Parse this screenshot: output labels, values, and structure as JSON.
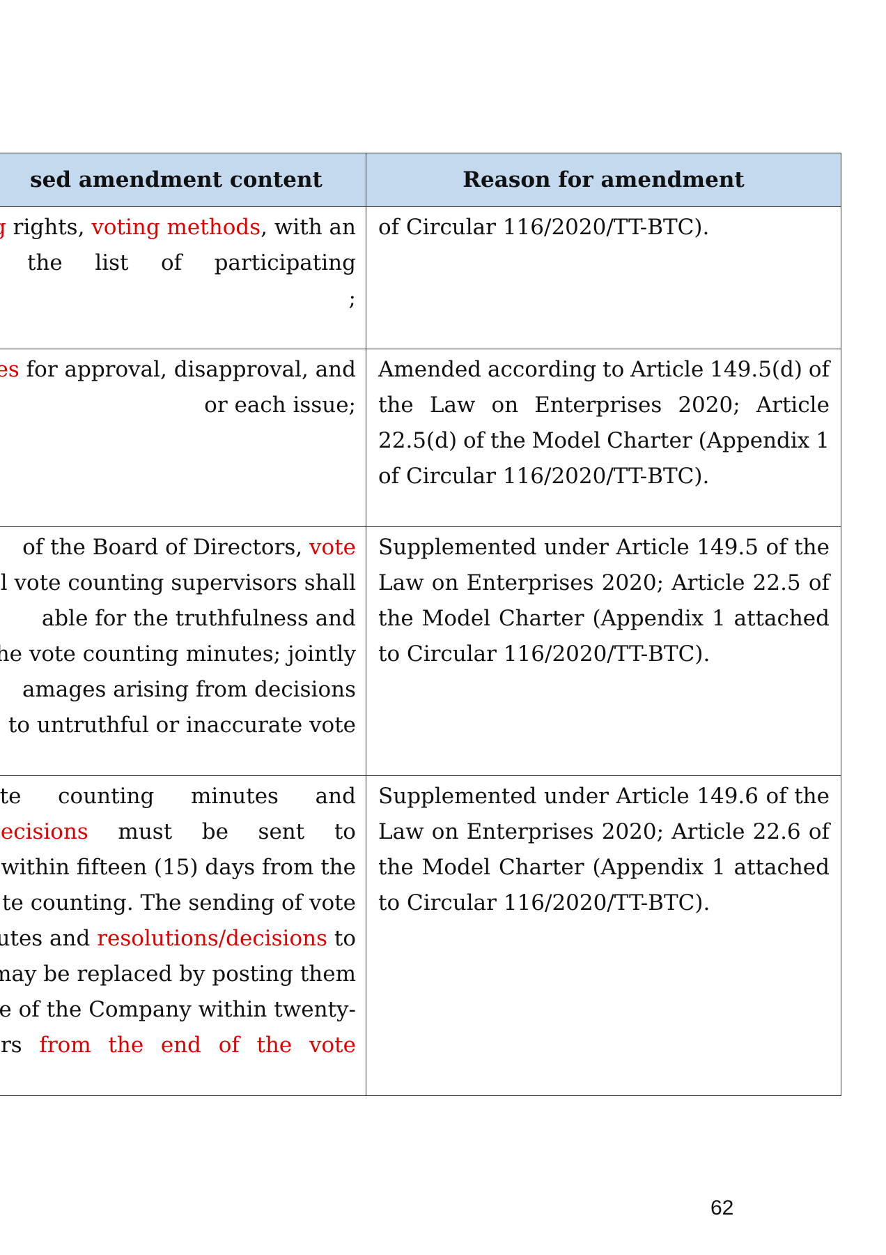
{
  "header": {
    "col1": "sed amendment content",
    "col2": "Reason for amendment"
  },
  "rows": [
    {
      "left": [
        {
          "segments": [
            {
              "t": "g",
              "red": true
            },
            {
              "t": " rights, "
            },
            {
              "t": "voting methods",
              "red": true
            },
            {
              "t": ", with an"
            }
          ]
        },
        {
          "words": [
            "f",
            "the",
            "list",
            "of",
            "participating"
          ]
        },
        {
          "segments": [
            {
              "t": ";"
            }
          ]
        }
      ],
      "right": [
        "of Circular 116/2020/TT-BTC)."
      ]
    },
    {
      "left": [
        {
          "segments": [
            {
              "t": "es",
              "red": true
            },
            {
              "t": " for approval, disapproval, and"
            }
          ]
        },
        {
          "segments": [
            {
              "t": "or each issue;"
            }
          ]
        }
      ],
      "right": [
        "Amended according to Article 149.5(d) of",
        "the Law on Enterprises 2020; Article",
        "22.5(d) of the Model Charter (Appendix 1",
        "of Circular 116/2020/TT-BTC)."
      ]
    },
    {
      "left": [
        {
          "segments": [
            {
              "t": "of the Board of Directors, "
            },
            {
              "t": "vote",
              "red": true
            }
          ]
        },
        {
          "segments": [
            {
              "t": "l vote counting supervisors shall"
            }
          ]
        },
        {
          "segments": [
            {
              "t": "able for the truthfulness and"
            }
          ]
        },
        {
          "segments": [
            {
              "t": "he vote counting minutes; jointly"
            }
          ]
        },
        {
          "segments": [
            {
              "t": "amages arising from decisions"
            }
          ]
        },
        {
          "segments": [
            {
              "t": " to untruthful or inaccurate vote"
            }
          ]
        }
      ],
      "right": [
        "Supplemented under Article 149.5 of the",
        "Law on Enterprises 2020; Article 22.5 of",
        "the Model Charter (Appendix 1 attached",
        "to Circular 116/2020/TT-BTC)."
      ]
    },
    {
      "left": [
        {
          "words": [
            "ote",
            "counting",
            "minutes",
            "and"
          ]
        },
        {
          "wordsRed": [
            [
              "decisions",
              true
            ],
            [
              "must",
              false
            ],
            [
              "be",
              false
            ],
            [
              "sent",
              false
            ],
            [
              "to",
              false
            ]
          ]
        },
        {
          "segments": [
            {
              "t": " within fifteen (15) days from the"
            }
          ]
        },
        {
          "segments": [
            {
              "t": "te counting. The sending of vote"
            }
          ]
        },
        {
          "segments": [
            {
              "t": "utes and "
            },
            {
              "t": "resolutions/decisions",
              "red": true
            },
            {
              "t": " to"
            }
          ]
        },
        {
          "segments": [
            {
              "t": " may be replaced by posting them"
            }
          ]
        },
        {
          "segments": [
            {
              "t": "e of the Company within twenty-"
            }
          ]
        },
        {
          "wordsRed": [
            [
              "urs",
              false
            ],
            [
              "from",
              true
            ],
            [
              "the",
              true
            ],
            [
              "end",
              true
            ],
            [
              "of",
              true
            ],
            [
              "the",
              true
            ],
            [
              "vote",
              true
            ]
          ]
        }
      ],
      "right": [
        "Supplemented under Article 149.6 of the",
        "Law on Enterprises 2020; Article 22.6 of",
        "the Model Charter (Appendix 1 attached",
        "to Circular 116/2020/TT-BTC)."
      ]
    }
  ],
  "page_number": "62"
}
